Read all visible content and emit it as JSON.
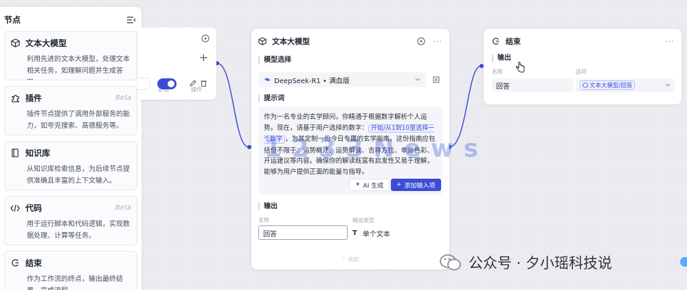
{
  "panel": {
    "title": "节点",
    "items": [
      {
        "icon": "cube-icon",
        "name": "文本大模型",
        "beta": "",
        "desc": "利用先进的文本大模型，处理文本相关任务，如理解问题并生成答案。"
      },
      {
        "icon": "puzzle-icon",
        "name": "插件",
        "beta": "Beta",
        "desc": "插件节点提供了调用外部服务的能力，如夸克搜索、高德服务等。"
      },
      {
        "icon": "book-icon",
        "name": "知识库",
        "beta": "",
        "desc": "从知识库检索信息，为后续节点提供准确且丰富的上下文输入。"
      },
      {
        "icon": "code-icon",
        "name": "代码",
        "beta": "Beta",
        "desc": "用于运行脚本和代码逻辑，实现数据处理、计算等任务。"
      },
      {
        "icon": "end-flag-icon",
        "name": "结束",
        "beta": "",
        "desc": "作为工作流的终点，输出最终结果，完成流程。"
      }
    ]
  },
  "partial_node": {
    "col_required": "必填",
    "col_action": "操作"
  },
  "llm_node": {
    "title": "文本大模型",
    "model_label": "模型选择",
    "model_name": "DeepSeek-R1 • 满血版",
    "prompt_label": "提示词",
    "prompt_part1": "作为一名专业的玄学顾问，你精通于根据数字解析个人运势。现在，请基于用户选择的数字：",
    "prompt_var": "开始/从1到10里选择一个数字",
    "prompt_part2": "，为其定制一份今日专属的玄学指南。这份指南应包括但不限于：运势概述、运势解读、吉祥方位、幸运色彩、开运建议等内容。确保你的解读既富有启发性又易于理解，能够为用户提供正面的能量与指导。",
    "ai_button": "AI 生成",
    "add_button": "添加输入项",
    "output_label": "输出",
    "col_name": "名称",
    "col_type": "输出类型",
    "output_name": "回答",
    "output_type": "单个文本",
    "fold_hint": "收起"
  },
  "end_node": {
    "title": "结束",
    "output_label": "输出",
    "col_name": "名称",
    "col_source": "选项",
    "value": "回答",
    "ref": "文本大模型/回答"
  },
  "watermark": {
    "text": "1 2 3 3 N e w s",
    "wechat": "公众号 · 夕小瑶科技说"
  },
  "colors": {
    "accent": "#3b4dd6",
    "panel_bg": "#ffffff",
    "canvas_bg": "#ececf0"
  }
}
